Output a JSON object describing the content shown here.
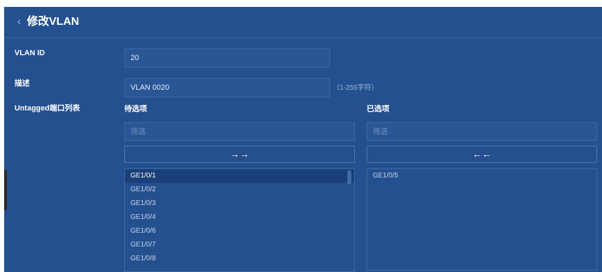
{
  "header": {
    "back_icon": "‹",
    "title": "修改VLAN"
  },
  "form": {
    "vlan_id": {
      "label": "VLAN ID",
      "value": "20"
    },
    "description": {
      "label": "描述",
      "value": "VLAN 0020",
      "hint": "（1-255字符）"
    },
    "untagged": {
      "label": "Untagged端口列表"
    }
  },
  "available": {
    "title": "待选项",
    "filter_placeholder": "筛选",
    "move_button": "→→",
    "items": [
      "GE1/0/1",
      "GE1/0/2",
      "GE1/0/3",
      "GE1/0/4",
      "GE1/0/6",
      "GE1/0/7",
      "GE1/0/8"
    ],
    "selected_item": "GE1/0/1"
  },
  "selected": {
    "title": "已选项",
    "filter_placeholder": "筛选",
    "move_button": "←←",
    "items": [
      "GE1/0/5"
    ]
  }
}
